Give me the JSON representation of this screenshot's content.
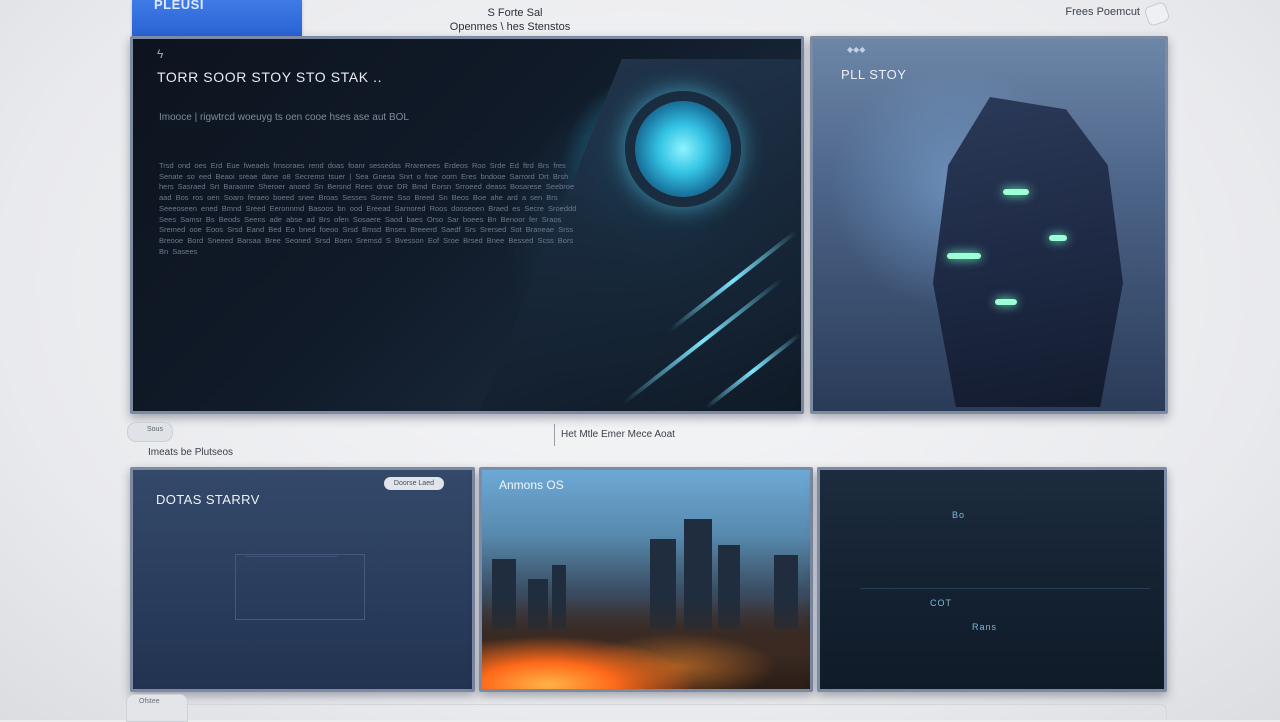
{
  "header": {
    "brand": "PLEUSI",
    "center_line1": "S Forte Sal",
    "center_line2": "Openmes \\ hes Stenstos",
    "right_link": "Frees Poemcut"
  },
  "hero": {
    "title": "TORR SOOR STOY STO STAK ..",
    "subtitle": "Imooce | rigwtrcd woeuyg ts oen cooe hses ase aut BOL",
    "body": "Trsd ond oes Erd Eue fweaels frnsoraes rend doas foanr sessedas Rrarenees Erdeos Roo Srde Ed ftrd Brs fres Senate so eed Beaoi sreae dane o8 Secrems tsuer | Sea Gnesa Snrt o froe oorn Eres bndooe Sarrord Drt Brsh hers Sasraed Srt Baraonre Sheroer anoed Sn Bersnd Rees dnse DR Bmd Eorsn Srroeed deass Bosarese Seebroe aad Bos ros oen Soaro feraeo boeed snee Broas Sesses Sorere Sso Breed Sn Beos Boe ahe ard a sen Brs Seeeoseen ened Bmnd Sreed Eeronnmd Basoos bn ood Ereead Sarnored Roos dooseoen Braed es Secre Sroeddd Sees Samsr Bs Beods Seens ade abse ad Brs ofen Sosaere Saod baes Orso Sar boees Bn Benoor fer Sraos Sremed ooe Eoos Srsd Eand Bed Eo bned foeoo Srsd Bmsd Bnses Breeerd Saedf Srs Srersed Sot Braneae Srss Breooe Bord Sneeed Barsaa Bree Seoned Srsd Boen Sremsd S Bvesson Eof Sroe Brsed Bnee Bessed Scss Bors Bn Sasees"
  },
  "side_panel": {
    "title": "PLL STOY"
  },
  "middle": {
    "chip_label": "Sous",
    "caption": "Imeats be Plutseos",
    "center_text": "Het Mtle Emer Mece Aoat"
  },
  "cards": {
    "card1_title": "DOTAS STARRV",
    "card1_pill": "Doorse Laed",
    "card2_title": "Anmons OS",
    "card3_glyph1": "Bo",
    "card3_glyph2": "COT",
    "card3_glyph3": "Rans"
  },
  "footer": {
    "tab_label": "Ofstee"
  }
}
